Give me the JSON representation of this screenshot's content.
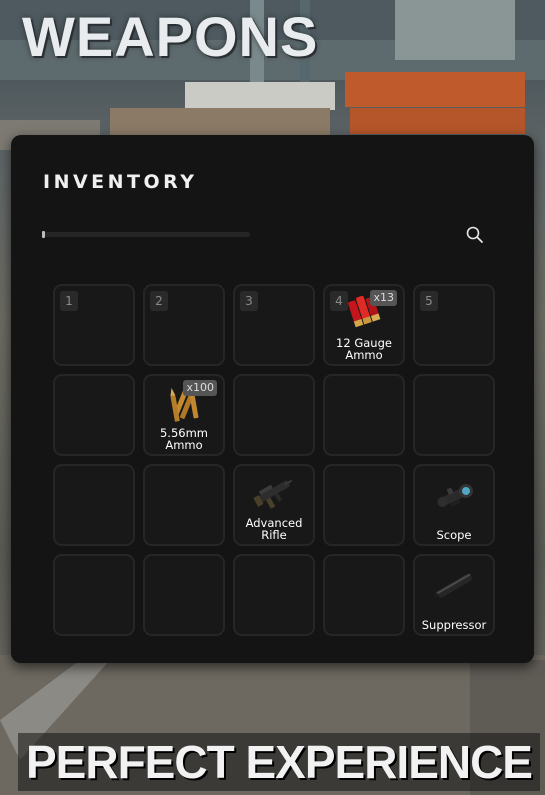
{
  "overlay": {
    "headline_top": "WEAPONS",
    "headline_bottom": "PERFECT EXPERIENCE"
  },
  "inventory": {
    "title": "INVENTORY",
    "search": {
      "value": "",
      "icon": "search-icon"
    },
    "slots": [
      {
        "number": "1",
        "item": null
      },
      {
        "number": "2",
        "item": null
      },
      {
        "number": "3",
        "item": null
      },
      {
        "number": "4",
        "item": {
          "name": "12 Gauge Ammo",
          "label": "12 Gauge\nAmmo",
          "quantity": "x13",
          "icon": "shotgun-shells-icon"
        }
      },
      {
        "number": "5",
        "item": null
      },
      {
        "number": "",
        "item": null
      },
      {
        "number": "",
        "item": {
          "name": "5.56mm Ammo",
          "label": "5.56mm\nAmmo",
          "quantity": "x100",
          "icon": "rifle-bullets-icon"
        }
      },
      {
        "number": "",
        "item": null
      },
      {
        "number": "",
        "item": null
      },
      {
        "number": "",
        "item": null
      },
      {
        "number": "",
        "item": null
      },
      {
        "number": "",
        "item": null
      },
      {
        "number": "",
        "item": {
          "name": "Advanced Rifle",
          "label": "Advanced\nRifle",
          "quantity": "",
          "icon": "advanced-rifle-icon"
        }
      },
      {
        "number": "",
        "item": null
      },
      {
        "number": "",
        "item": {
          "name": "Scope",
          "label": "Scope",
          "quantity": "",
          "icon": "scope-icon"
        }
      },
      {
        "number": "",
        "item": null
      },
      {
        "number": "",
        "item": null
      },
      {
        "number": "",
        "item": null
      },
      {
        "number": "",
        "item": null
      },
      {
        "number": "",
        "item": {
          "name": "Suppressor",
          "label": "Suppressor",
          "quantity": "",
          "icon": "suppressor-icon"
        }
      }
    ]
  },
  "colors": {
    "panel_bg": "#141414",
    "slot_bg": "#181818",
    "slot_border": "#262626",
    "text": "#ffffff",
    "badge_bg": "#555555"
  }
}
